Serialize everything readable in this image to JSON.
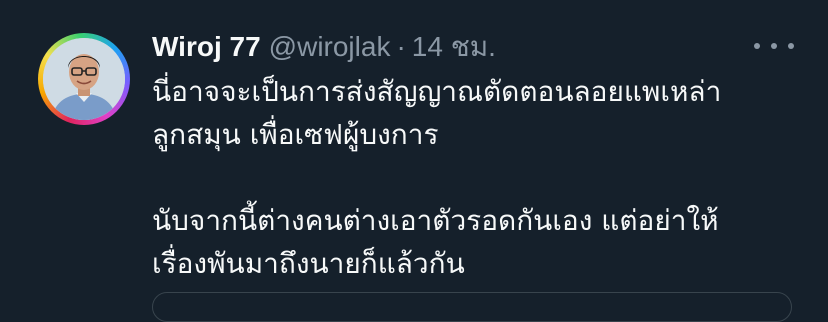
{
  "tweet": {
    "author": {
      "name": "Wiroj 77",
      "handle": "@wirojlak",
      "separator": "·",
      "time": "14 ชม."
    },
    "lines": [
      "นี่อาจจะเป็นการส่งสัญญาณตัดตอนลอยแพเหล่า",
      "ลูกสมุน เพื่อเซฟผู้บงการ",
      "นับจากนี้ต่างคนต่างเอาตัวรอดกันเอง แต่อย่าให้",
      "เรื่องพันมาถึงนายก็แล้วกัน"
    ],
    "icons": {
      "avatar": "profile-photo",
      "more": "more-horizontal-icon"
    },
    "colors": {
      "background": "#15202b",
      "primary_text": "#f7f9f9",
      "secondary_text": "#8b98a5"
    }
  }
}
